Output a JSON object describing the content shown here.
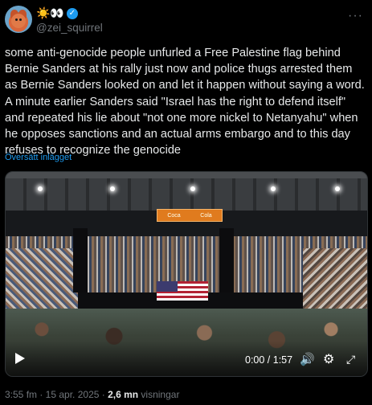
{
  "post": {
    "display_name": "☀️👀",
    "handle": "@zei_squirrel",
    "text": "some anti-genocide people unfurled a Free Palestine flag behind Bernie Sanders at his rally just now and police thugs arrested them as Bernie Sanders looked on and let it happen without saying a word. A minute earlier Sanders said \"Israel has the right to defend itself\" and repeated his lie about \"not one more nickel to Netanyahu\" when he opposes sanctions and an actual arms embargo and to this day refuses to recognize the genocide",
    "translate_label": "Översätt inlägget",
    "more_icon": "more-icon"
  },
  "video": {
    "time": "0:00 / 1:57",
    "scoreboard_left": "Coca",
    "scoreboard_right": "Cola",
    "icons": [
      "play-icon",
      "volume-icon",
      "settings-icon",
      "fullscreen-icon"
    ]
  },
  "meta": {
    "datetime": "3:55 fm · 15 apr. 2025 · ",
    "views_count": "2,6 mn",
    "views_label": " visningar"
  },
  "colors": {
    "background": "#000000",
    "text": "#e7e9ea",
    "secondary": "#71767b",
    "accent": "#1d9bf0"
  }
}
